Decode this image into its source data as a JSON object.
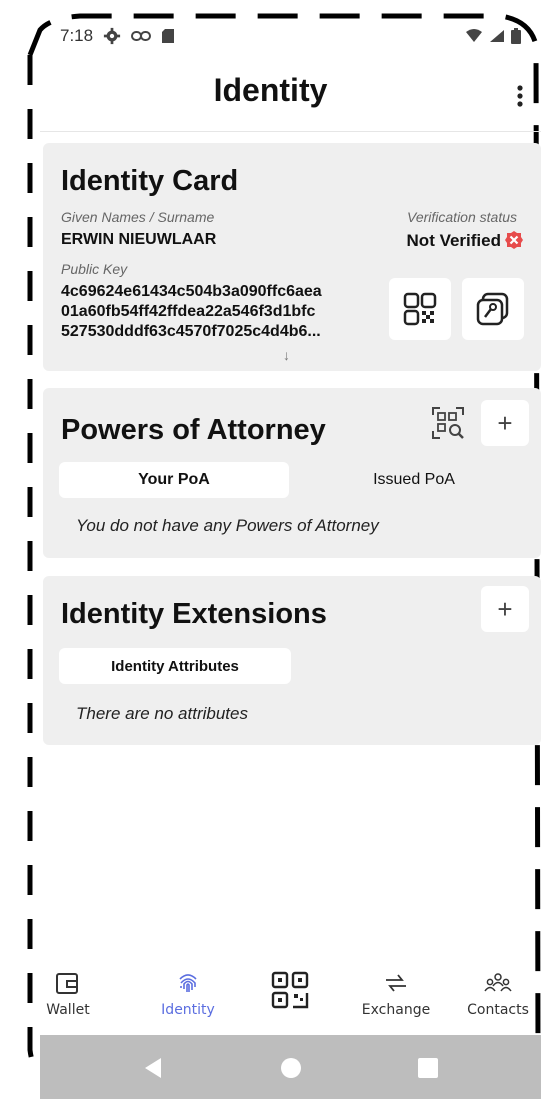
{
  "status_bar": {
    "time": "7:18",
    "icons_left": [
      "gear-icon",
      "link-icon",
      "sd-card-icon"
    ],
    "icons_right": [
      "wifi-icon",
      "signal-icon",
      "battery-icon"
    ]
  },
  "app_bar": {
    "title": "Identity",
    "menu_icon": "more-vert-icon"
  },
  "identity_card": {
    "title": "Identity Card",
    "name_label": "Given Names / Surname",
    "name_value": "ERWIN NIEUWLAAR",
    "verification_label": "Verification status",
    "verification_value": "Not Verified",
    "public_key_label": "Public Key",
    "public_key_lines": [
      "4c69624e61434c504b3a090ffc6aea",
      "01a60fb54ff42ffdea22a546f3d1bfc",
      "527530dddf63c4570f7025c4d4b6..."
    ],
    "expand_glyph": "↓"
  },
  "powers_of_attorney": {
    "title": "Powers of Attorney",
    "add_glyph": "+",
    "tabs": [
      {
        "label": "Your PoA",
        "active": true
      },
      {
        "label": "Issued PoA",
        "active": false
      }
    ],
    "empty_text": "You do not have any Powers of Attorney"
  },
  "identity_extensions": {
    "title": "Identity Extensions",
    "add_glyph": "+",
    "tab_label": "Identity Attributes",
    "empty_text": "There are no attributes"
  },
  "bottom_nav": {
    "items": [
      {
        "label": "Wallet",
        "icon": "wallet-icon",
        "active": false
      },
      {
        "label": "Identity",
        "icon": "fingerprint-icon",
        "active": true
      },
      {
        "label": "",
        "icon": "qr-scan-icon",
        "active": false
      },
      {
        "label": "Exchange",
        "icon": "exchange-icon",
        "active": false
      },
      {
        "label": "Contacts",
        "icon": "contacts-icon",
        "active": false
      }
    ]
  },
  "colors": {
    "accent": "#5b6ee0",
    "error": "#e74c4c",
    "card_bg": "#efefef",
    "system_bar": "#bdbdbd"
  }
}
